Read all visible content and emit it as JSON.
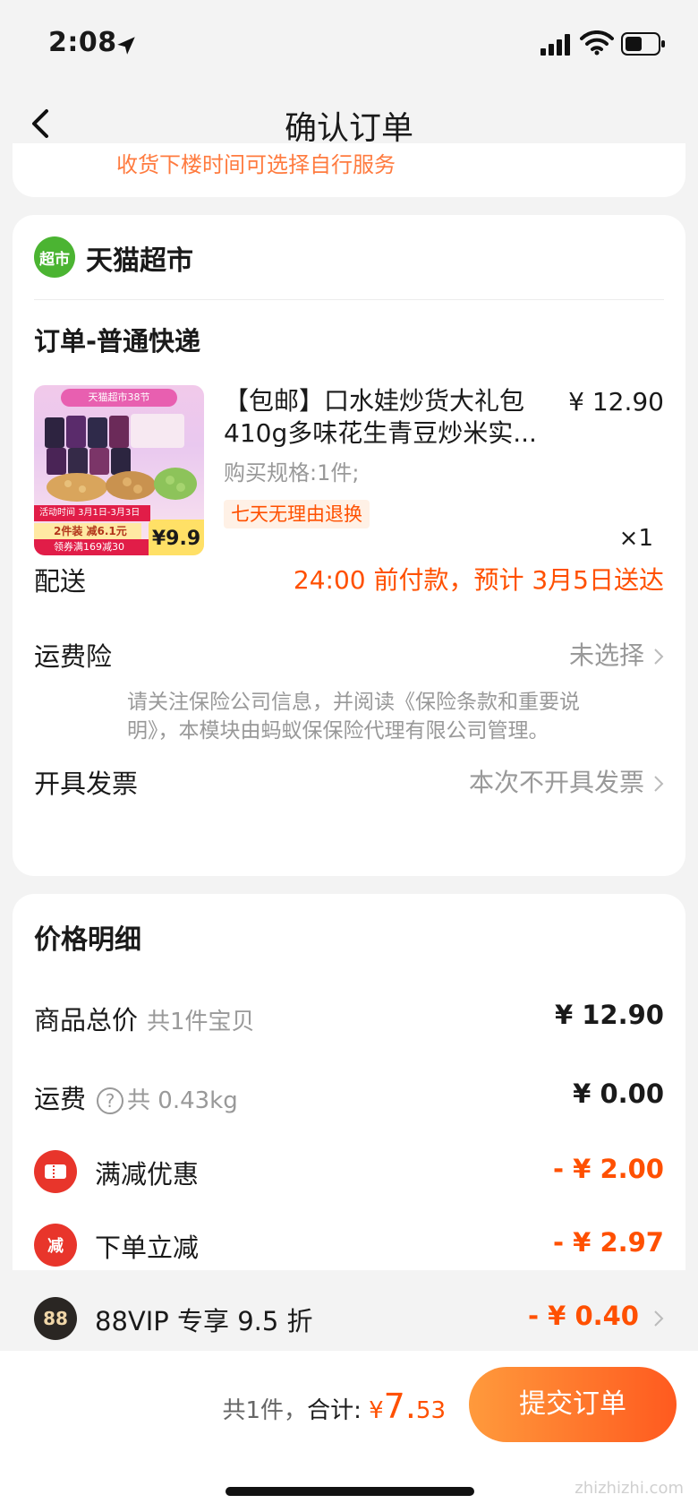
{
  "status_bar": {
    "time": "2:08"
  },
  "nav": {
    "title": "确认订单"
  },
  "top_card": {
    "cut_text": "收货下楼时间可选择自行服务"
  },
  "shop": {
    "logo_text": "超市",
    "name": "天猫超市",
    "order_type": "订单-普通快递",
    "product": {
      "title": "【包邮】口水娃炒货大礼包410g多味花生青豆炒米实...",
      "price": "¥ 12.90",
      "spec": "购买规格:1件;",
      "badge": "七天无理由退换",
      "qty": "×1",
      "thumb": {
        "banner": "天猫超市38节",
        "promo": "活动时间 3月1日-3月3日20点",
        "tag2": "2件装 减6.1元",
        "tag3": "领券满169减30",
        "price": "¥9.9"
      }
    },
    "delivery": {
      "label": "配送",
      "value": "24:00 前付款，预计 3月5日送达"
    },
    "insurance": {
      "label": "运费险",
      "value": "未选择",
      "note": "请关注保险公司信息，并阅读《保险条款和重要说明》，本模块由蚂蚁保保险代理有限公司管理。"
    },
    "invoice": {
      "label": "开具发票",
      "value": "本次不开具发票"
    }
  },
  "price_detail": {
    "title": "价格明细",
    "rows": [
      {
        "label": "商品总价",
        "sub": "共1件宝贝",
        "value": "¥ 12.90"
      },
      {
        "label": "运费",
        "sub": "共 0.43kg",
        "value": "¥ 0.00"
      },
      {
        "label": "满减优惠",
        "value": "- ¥ 2.00",
        "icon": "ticket-icon"
      },
      {
        "label": "下单立减",
        "value": "- ¥ 2.97",
        "icon_text": "减"
      },
      {
        "label": "88VIP 专享 9.5 折",
        "value": "- ¥ 0.40",
        "icon_text": "88"
      }
    ]
  },
  "bottom": {
    "count": "共1件，",
    "total_label": "合计:",
    "currency": "¥",
    "amount_int": "7.",
    "amount_dec": "53",
    "submit": "提交订单"
  },
  "watermark": "zhizhizhi.com",
  "colors": {
    "accent": "#ff5000",
    "shop_green": "#4bb432",
    "submit_start": "#ff9a3c",
    "submit_end": "#ff5a1f"
  }
}
